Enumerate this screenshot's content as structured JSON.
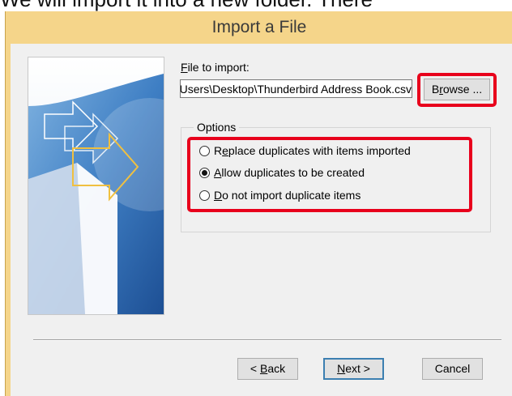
{
  "background_text": "We will import it into a new folder. There",
  "dialog": {
    "title": "Import a File",
    "file_label_mnemonic": "F",
    "file_label_rest": "ile to import:",
    "file_path_value": "C:\\Users\\Desktop\\Thunderbird Address Book.csv",
    "browse_label_before": "B",
    "browse_label_mnemonic": "r",
    "browse_label_after": "owse ...",
    "options_legend": "Options",
    "options": [
      {
        "pre": "R",
        "mn": "e",
        "post": "place duplicates with items imported",
        "checked": false
      },
      {
        "pre": "",
        "mn": "A",
        "post": "llow duplicates to be created",
        "checked": true
      },
      {
        "pre": "",
        "mn": "D",
        "post": "o not import duplicate items",
        "checked": false
      }
    ],
    "back_pre": "< ",
    "back_mn": "B",
    "back_post": "ack",
    "next_mn": "N",
    "next_post": "ext >",
    "cancel_label": "Cancel"
  },
  "colors": {
    "highlight": "#e8001c",
    "title_bar": "#f5d58a",
    "client_bg": "#f0f0f0"
  }
}
